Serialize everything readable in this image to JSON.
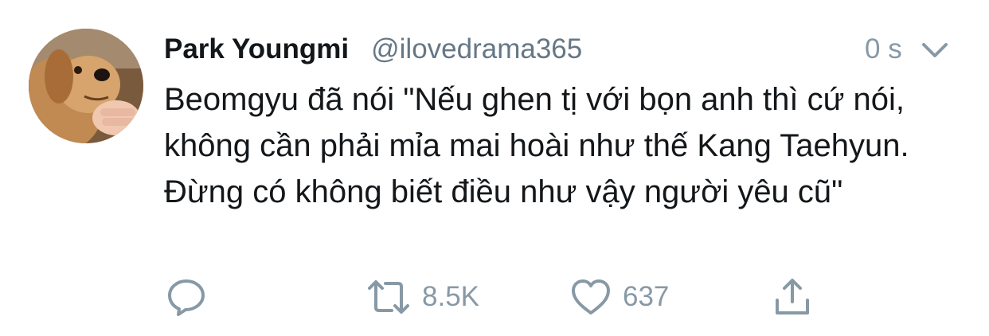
{
  "tweet": {
    "author_name": "Park Youngmi",
    "author_handle": "@ilovedrama365",
    "timestamp": "0 s",
    "text": "Beomgyu đã nói \"Nếu ghen tị với bọn anh thì cứ nói, không cần phải mỉa mai hoài như thế Kang Taehyun. Đừng có không biết điều như vậy người yêu cũ\""
  },
  "actions": {
    "retweet_count": "8.5K",
    "like_count": "637"
  },
  "colors": {
    "text": "#14171a",
    "muted": "#8899a6",
    "icon": "#8899a6"
  },
  "icons": [
    "reply-icon",
    "retweet-icon",
    "like-icon",
    "share-icon",
    "chevron-down-icon"
  ]
}
